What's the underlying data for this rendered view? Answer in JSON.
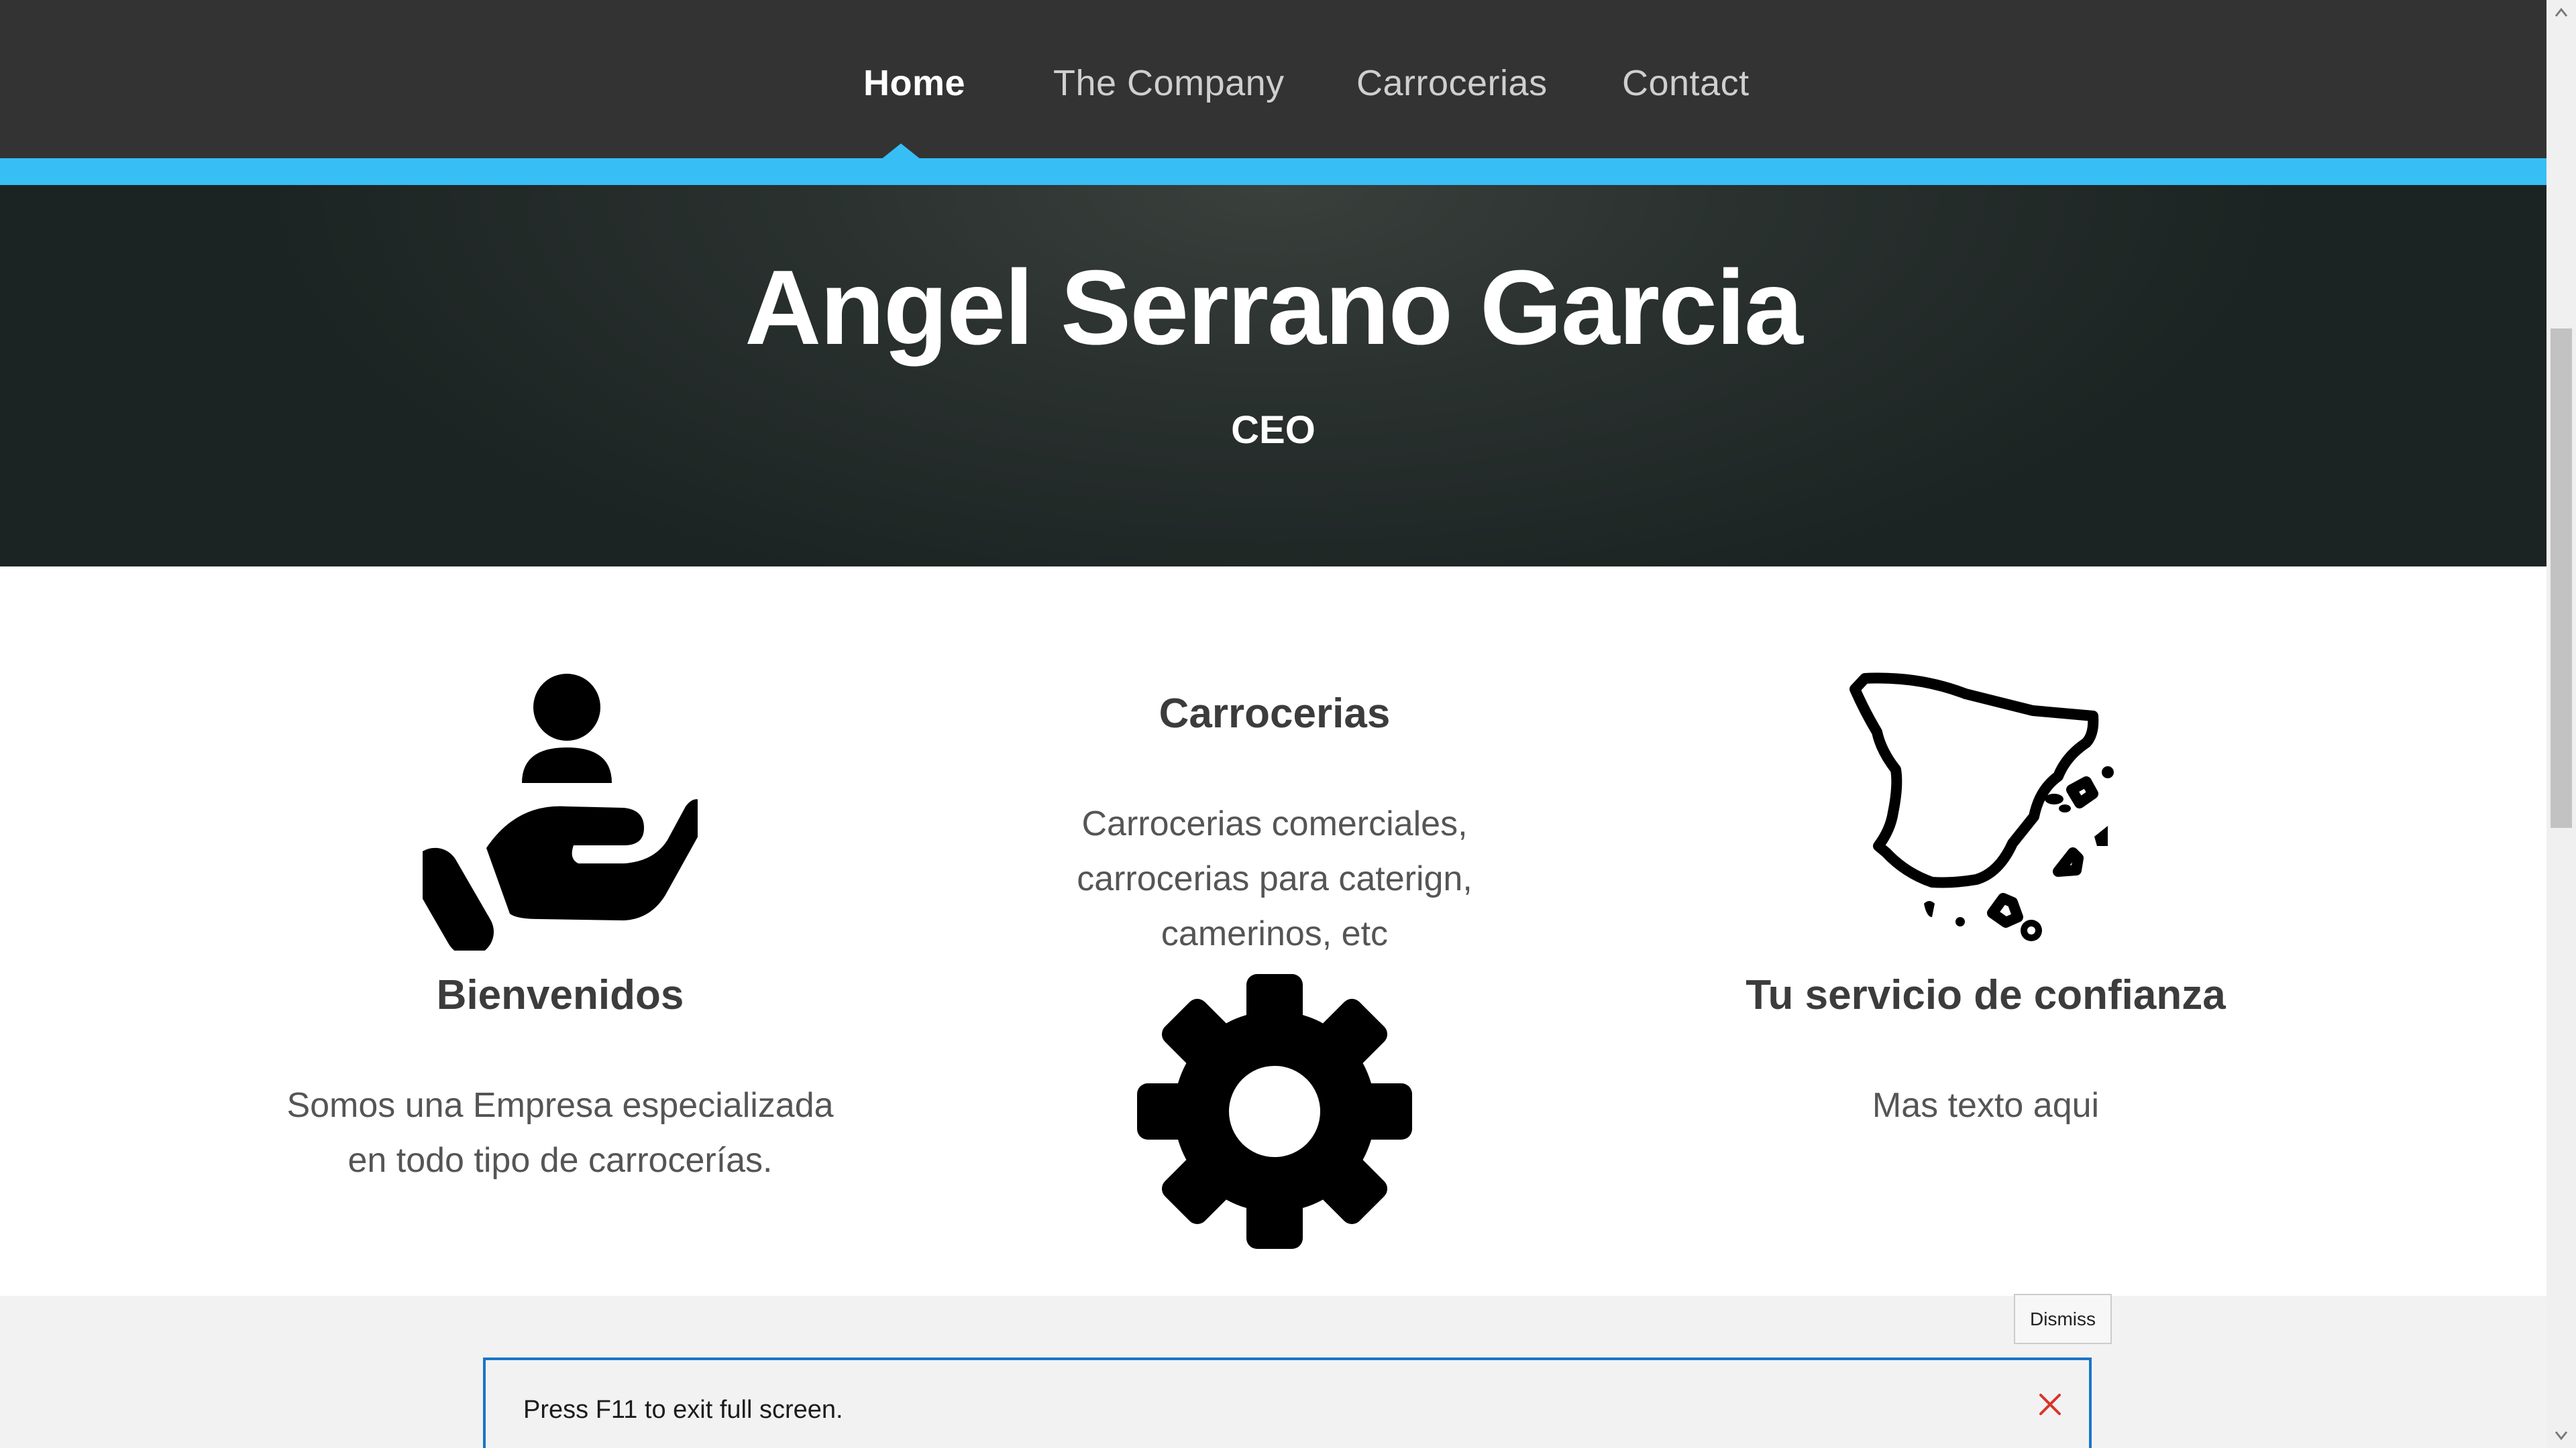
{
  "nav": {
    "items": [
      {
        "label": "Home",
        "active": true
      },
      {
        "label": "The Company",
        "active": false
      },
      {
        "label": "Carrocerias",
        "active": false
      },
      {
        "label": "Contact",
        "active": false
      }
    ]
  },
  "hero": {
    "title": "Angel Serrano Garcia",
    "subtitle": "CEO"
  },
  "features": [
    {
      "icon": "person-in-hand-icon",
      "title": "Bienvenidos",
      "text": "Somos una Empresa especializada en todo tipo de carrocerías."
    },
    {
      "icon": "gear-icon",
      "title": "Carrocerias",
      "text": "Carrocerias comerciales, carrocerias para caterign, camerinos, etc"
    },
    {
      "icon": "spain-map-icon",
      "title": "Tu servicio de confianza",
      "text": "Mas texto aqui"
    }
  ],
  "notification": {
    "message": "Press F11 to exit full screen.",
    "dismiss_label": "Dismiss",
    "close_icon": "close-icon"
  },
  "colors": {
    "nav_background": "#333333",
    "accent": "#37bef5",
    "hero_background": "#1c2423",
    "toast_border": "#1a74c9",
    "close_icon": "#d9342b"
  }
}
